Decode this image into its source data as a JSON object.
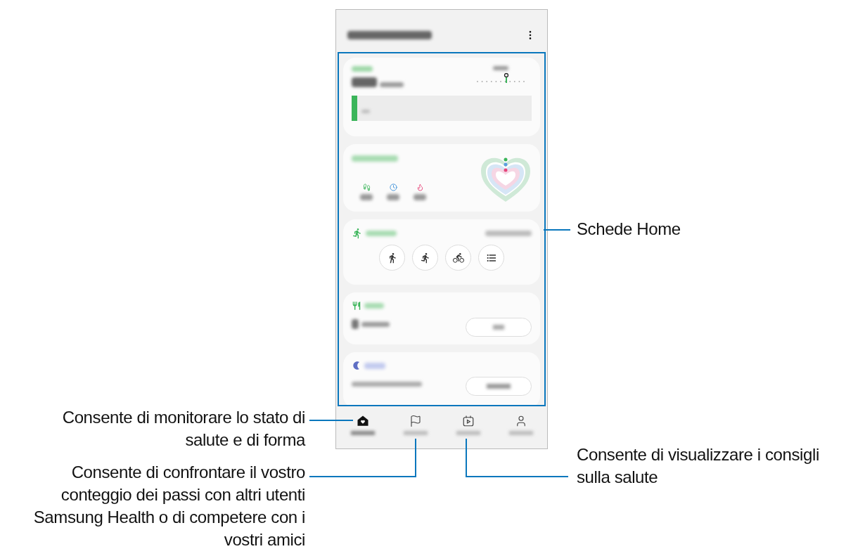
{
  "callouts": [
    {
      "text": "Schede Home"
    },
    {
      "text": "Consente di monitorare lo stato di salute e di forma"
    },
    {
      "text": "Consente di confrontare il vostro conteggio dei passi con altri utenti Samsung Health o di competere con i vostri amici"
    },
    {
      "text": "Consente di visualizzare i consigli sulla salute"
    }
  ],
  "steps_card": {
    "level": 0.03
  },
  "exercise_buttons": [
    {
      "kind": "walk"
    },
    {
      "kind": "run"
    },
    {
      "kind": "bike"
    },
    {
      "kind": "list"
    }
  ],
  "nav": [
    {
      "kind": "home",
      "selected": true
    },
    {
      "kind": "flag",
      "selected": false
    },
    {
      "kind": "calendar",
      "selected": false
    },
    {
      "kind": "person",
      "selected": false
    }
  ]
}
